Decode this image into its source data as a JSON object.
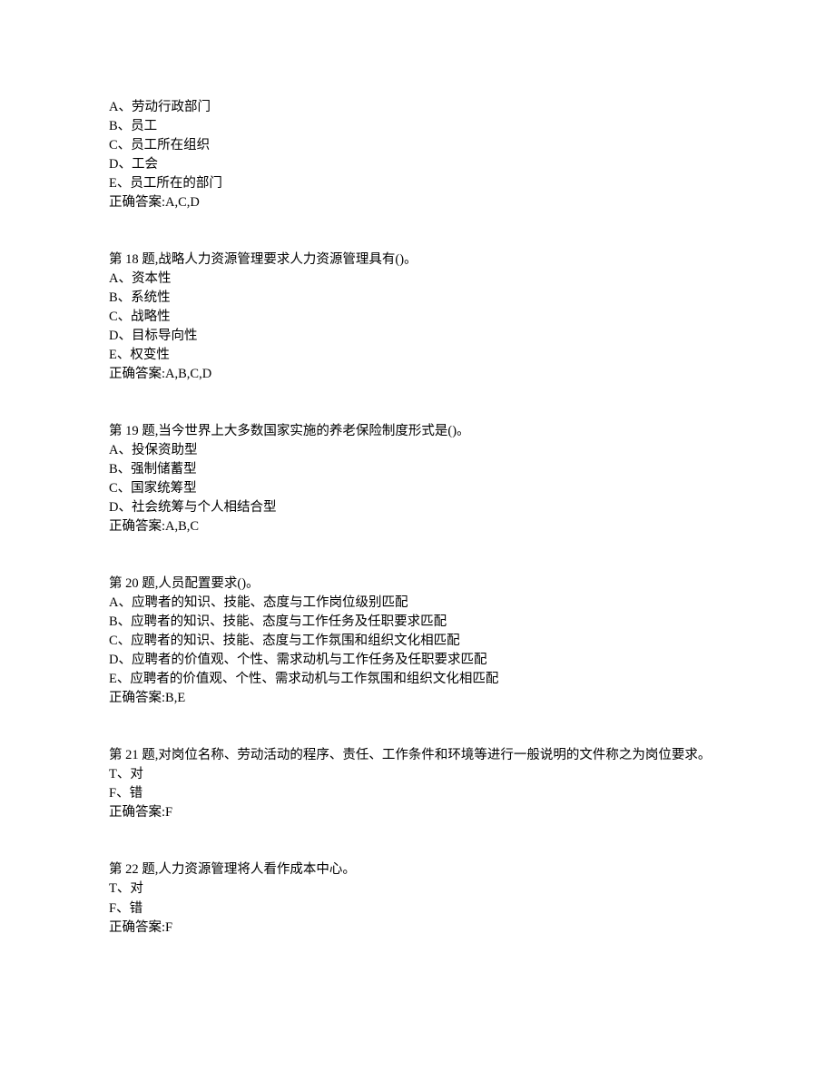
{
  "questions": [
    {
      "stem": "",
      "options": [
        "A、劳动行政部门",
        "B、员工",
        "C、员工所在组织",
        "D、工会",
        "E、员工所在的部门"
      ],
      "answer": "正确答案:A,C,D"
    },
    {
      "stem": "第 18 题,战略人力资源管理要求人力资源管理具有()。",
      "options": [
        "A、资本性",
        "B、系统性",
        "C、战略性",
        "D、目标导向性",
        "E、权变性"
      ],
      "answer": "正确答案:A,B,C,D"
    },
    {
      "stem": "第 19 题,当今世界上大多数国家实施的养老保险制度形式是()。",
      "options": [
        "A、投保资助型",
        "B、强制储蓄型",
        "C、国家统筹型",
        "D、社会统筹与个人相结合型"
      ],
      "answer": "正确答案:A,B,C"
    },
    {
      "stem": "第 20 题,人员配置要求()。",
      "options": [
        "A、应聘者的知识、技能、态度与工作岗位级别匹配",
        "B、应聘者的知识、技能、态度与工作任务及任职要求匹配",
        "C、应聘者的知识、技能、态度与工作氛围和组织文化相匹配",
        "D、应聘者的价值观、个性、需求动机与工作任务及任职要求匹配",
        "E、应聘者的价值观、个性、需求动机与工作氛围和组织文化相匹配"
      ],
      "answer": "正确答案:B,E"
    },
    {
      "stem": "第 21 题,对岗位名称、劳动活动的程序、责任、工作条件和环境等进行一般说明的文件称之为岗位要求。",
      "options": [
        "T、对",
        "F、错"
      ],
      "answer": "正确答案:F"
    },
    {
      "stem": "第 22 题,人力资源管理将人看作成本中心。",
      "options": [
        "T、对",
        "F、错"
      ],
      "answer": "正确答案:F"
    }
  ]
}
